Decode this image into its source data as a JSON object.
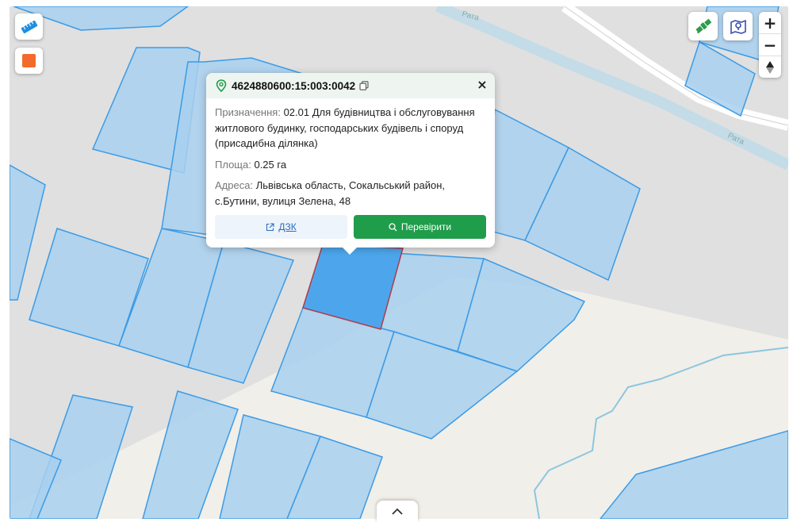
{
  "map": {
    "street_label_top": "Рата",
    "street_label_right": "Рата"
  },
  "controls": {
    "ruler_icon": "ruler-icon",
    "color_swatch": "#f26b2c",
    "satellite_icon": "satellite-icon",
    "map_layers_icon": "map-layers-icon",
    "zoom_in": "+",
    "zoom_out": "−",
    "compass": "compass-icon"
  },
  "popup": {
    "cadastral_number": "4624880600:15:003:0042",
    "purpose_label": "Призначення:",
    "purpose_value": "02.01 Для будівництва і обслуговування житлового будинку, господарських будівель і споруд (присадибна ділянка)",
    "area_label": "Площа:",
    "area_value": "0.25 га",
    "address_label": "Адреса:",
    "address_value": "Львівська область, Сокальський район, с.Бутини, вулиця Зелена, 48",
    "dzk_button": "ДЗК",
    "check_button": "Перевірити",
    "close_label": "×"
  },
  "colors": {
    "parcel_fill": "#a8d0ee",
    "parcel_stroke": "#3b9be6",
    "selected_fill": "#4da6ec",
    "selected_stroke": "#b03a4a",
    "accent_green": "#1f9d4a"
  }
}
